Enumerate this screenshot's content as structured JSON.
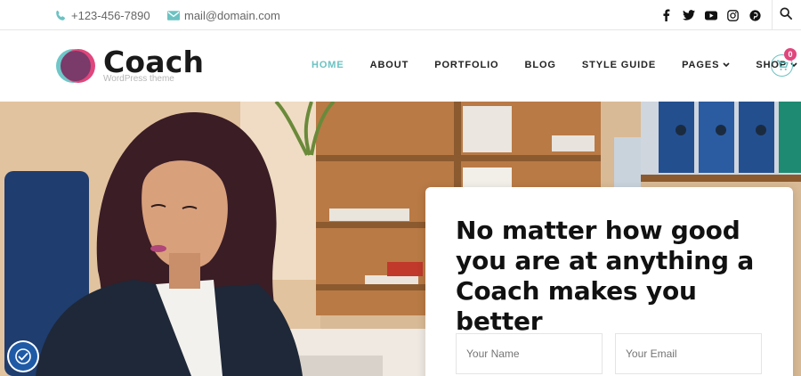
{
  "topbar": {
    "phone": "+123-456-7890",
    "email": "mail@domain.com",
    "socials": [
      "facebook-icon",
      "twitter-icon",
      "youtube-icon",
      "instagram-icon",
      "pinterest-icon"
    ],
    "search_icon": "search-icon"
  },
  "header": {
    "brand": "Coach",
    "tagline": "WordPress theme",
    "nav": [
      {
        "label": "HOME",
        "active": true
      },
      {
        "label": "ABOUT"
      },
      {
        "label": "PORTFOLIO"
      },
      {
        "label": "BLOG"
      },
      {
        "label": "STYLE GUIDE"
      },
      {
        "label": "PAGES",
        "dropdown": true
      },
      {
        "label": "SHOP",
        "dropdown": true
      }
    ],
    "cart_count": "0"
  },
  "hero": {
    "title": "No matter how good you are at anything a Coach makes you better",
    "name_placeholder": "Your Name",
    "email_placeholder": "Your Email"
  },
  "colors": {
    "accent": "#6cc2c2",
    "badge": "#e0467c",
    "logo_pink": "#e0467c",
    "logo_purple": "#7a3a6a"
  }
}
